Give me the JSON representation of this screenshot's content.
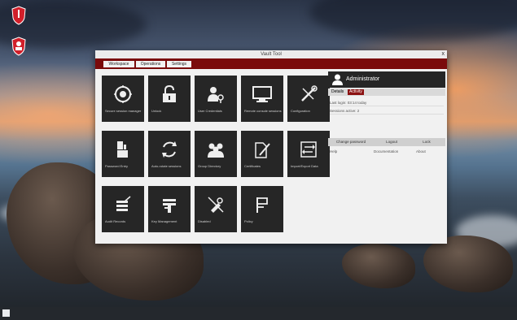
{
  "colors": {
    "accent": "#7a0b0b",
    "tile_bg": "#262626",
    "window_bg": "#f1f1f1",
    "desktop_icon_red": "#d11f2a"
  },
  "desktop": {
    "icons": [
      {
        "icon": "shield-app-icon"
      },
      {
        "icon": "shield-user-app-icon"
      }
    ]
  },
  "window": {
    "title": "Vault Tool",
    "close_label": "x",
    "tabs": [
      {
        "label": "Workspace"
      },
      {
        "label": "Operations"
      },
      {
        "label": "Settings"
      }
    ]
  },
  "tiles": [
    {
      "icon": "vault-lock-icon",
      "label": "Secure session manager"
    },
    {
      "icon": "unlock-icon",
      "label": "Unlock"
    },
    {
      "icon": "user-key-icon",
      "label": "User Credentials"
    },
    {
      "icon": "monitor-icon",
      "label": "Remote console sessions"
    },
    {
      "icon": "tools-icon",
      "label": "Configuration"
    },
    {
      "icon": "user-shield-icon",
      "label": "Password Entry"
    },
    {
      "icon": "sync-icon",
      "label": "Auto-rotate sessions"
    },
    {
      "icon": "group-icon",
      "label": "Group Directory"
    },
    {
      "icon": "document-pen-icon",
      "label": "Certificates"
    },
    {
      "icon": "transfer-icon",
      "label": "Import/Export Data"
    },
    {
      "icon": "stack-pen-icon",
      "label": "Audit Records"
    },
    {
      "icon": "stack-key-icon",
      "label": "Key Management"
    },
    {
      "icon": "broken-tool-icon",
      "label": "Disabled"
    },
    {
      "icon": "flag-icon",
      "label": "Policy"
    }
  ],
  "panel": {
    "user_icon": "user-icon",
    "user_name": "Administrator",
    "subtabs": [
      {
        "label": "Details"
      },
      {
        "label": "Activity"
      }
    ],
    "info": [
      {
        "text": "Last login: 03:14 today"
      },
      {
        "text": "Sessions active: 2"
      }
    ],
    "buttons": [
      {
        "label": "Change password"
      },
      {
        "label": "Logout"
      },
      {
        "label": "Lock"
      }
    ],
    "footer": [
      {
        "text": "Help"
      },
      {
        "text": "Documentation"
      },
      {
        "text": "About"
      }
    ]
  }
}
